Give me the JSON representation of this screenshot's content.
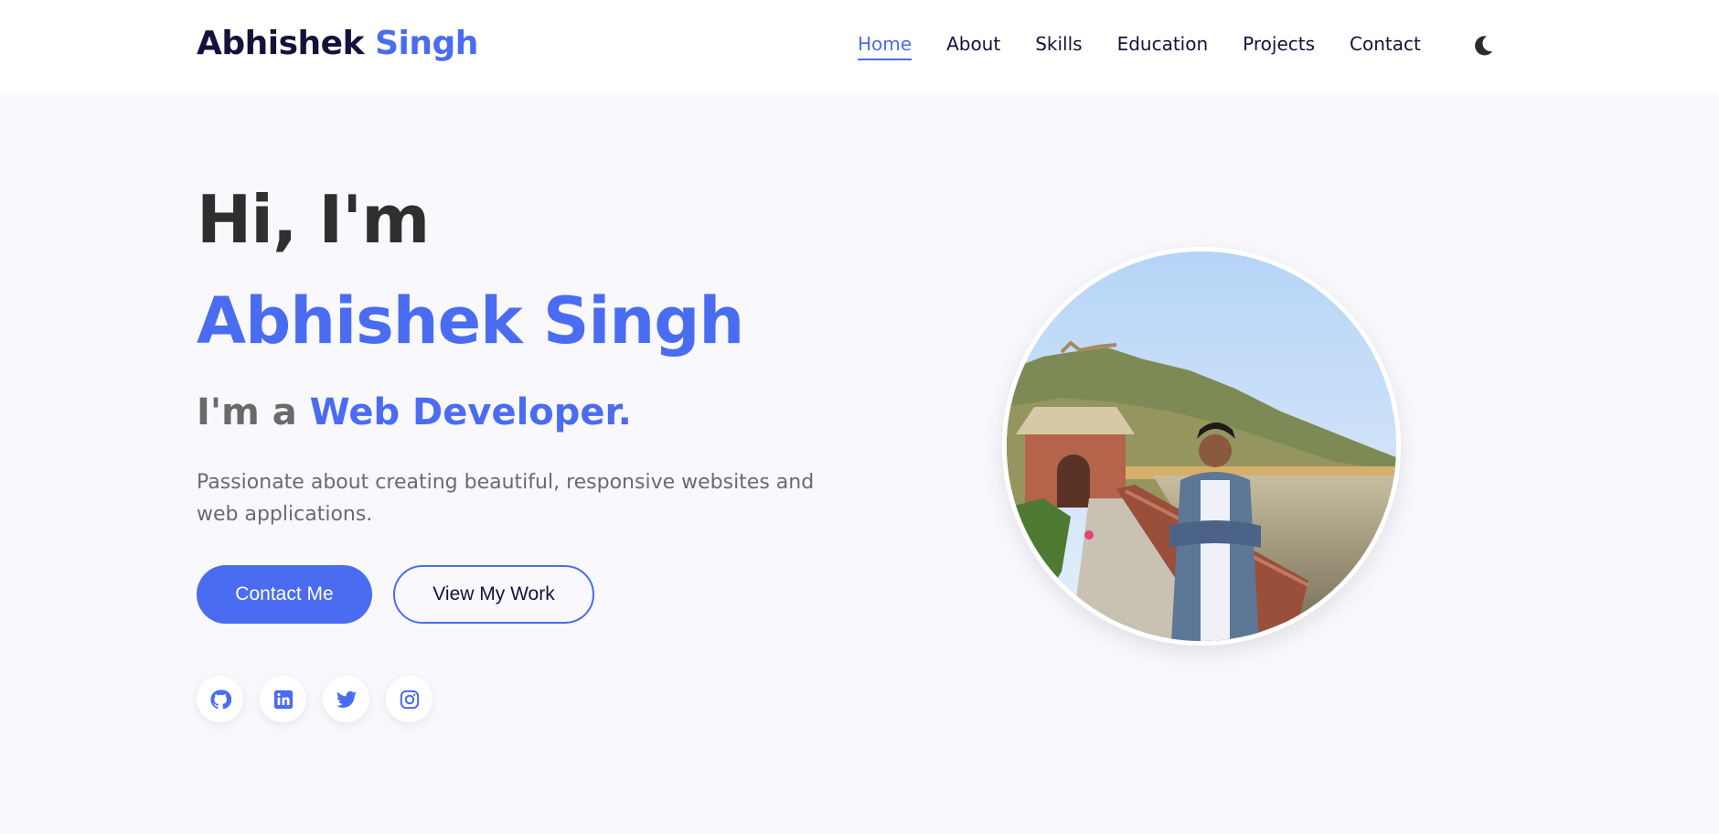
{
  "brand": {
    "first": "Abhishek",
    "last": "Singh"
  },
  "nav": {
    "items": [
      {
        "label": "Home",
        "active": true
      },
      {
        "label": "About",
        "active": false
      },
      {
        "label": "Skills",
        "active": false
      },
      {
        "label": "Education",
        "active": false
      },
      {
        "label": "Projects",
        "active": false
      },
      {
        "label": "Contact",
        "active": false
      }
    ],
    "theme_toggle_icon": "moon-icon"
  },
  "hero": {
    "greeting": "Hi, I'm",
    "name": "Abhishek Singh",
    "role_prefix": "I'm a",
    "role_typed": "Web Developer.",
    "description": "Passionate about creating beautiful, responsive websites and web applications.",
    "primary_button": "Contact Me",
    "secondary_button": "View My Work",
    "socials": [
      "github-icon",
      "linkedin-icon",
      "twitter-icon",
      "instagram-icon"
    ],
    "profile_image": "profile-photo"
  },
  "colors": {
    "accent": "#4a6cf0",
    "dark": "#12123a",
    "background": "#f9f8fd"
  }
}
